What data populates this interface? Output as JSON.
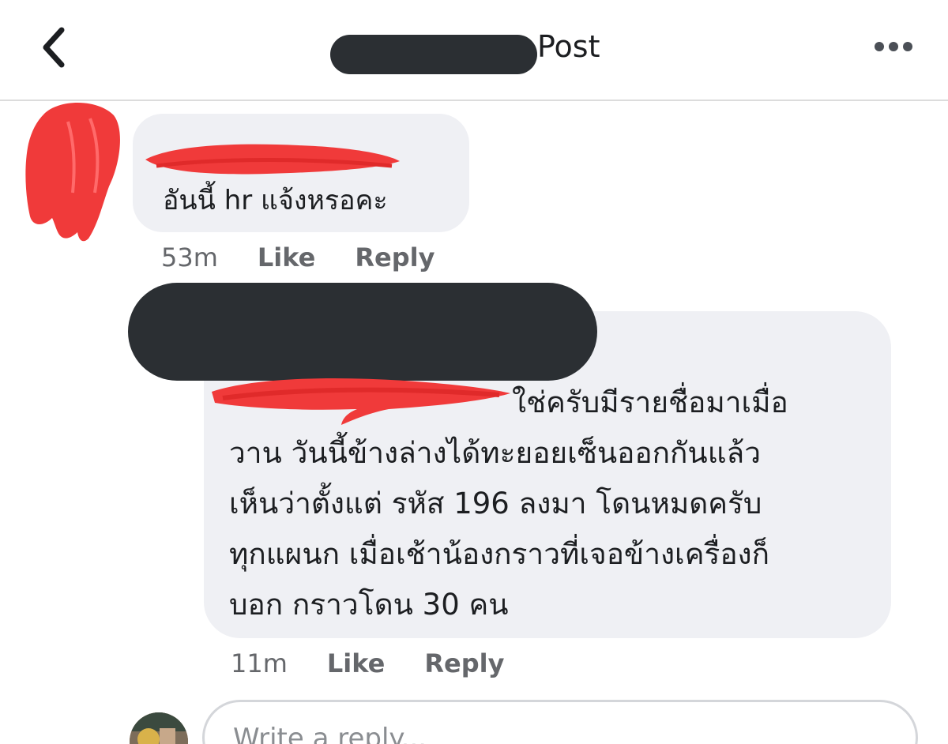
{
  "header": {
    "title": "Post",
    "back_icon": "chevron-left-icon",
    "more_icon": "more-horizontal-icon"
  },
  "comments": [
    {
      "text": "อันนี้ hr แจ้งหรอคะ",
      "time": "53m",
      "like_label": "Like",
      "reply_label": "Reply"
    },
    {
      "lines": [
        "ใช่ครับมีรายชื่อมาเมื่อ",
        "วาน วันนี้ข้างล่างได้ทะยอยเซ็นออกกันแล้ว",
        "เห็นว่าตั้งแต่ รหัส 196 ลงมา โดนหมดครับ",
        "ทุกแผนก เมื่อเช้าน้องกราวที่เจอข้างเครื่องก็",
        "บอก กราวโดน 30 คน"
      ],
      "time": "11m",
      "like_label": "Like",
      "reply_label": "Reply"
    }
  ],
  "composer": {
    "placeholder": "Write a reply..."
  },
  "colors": {
    "bubble": "#eff0f4",
    "meta_text": "#65676b",
    "redaction_dark": "#2b2f33",
    "redaction_red": "#f03a3a"
  }
}
